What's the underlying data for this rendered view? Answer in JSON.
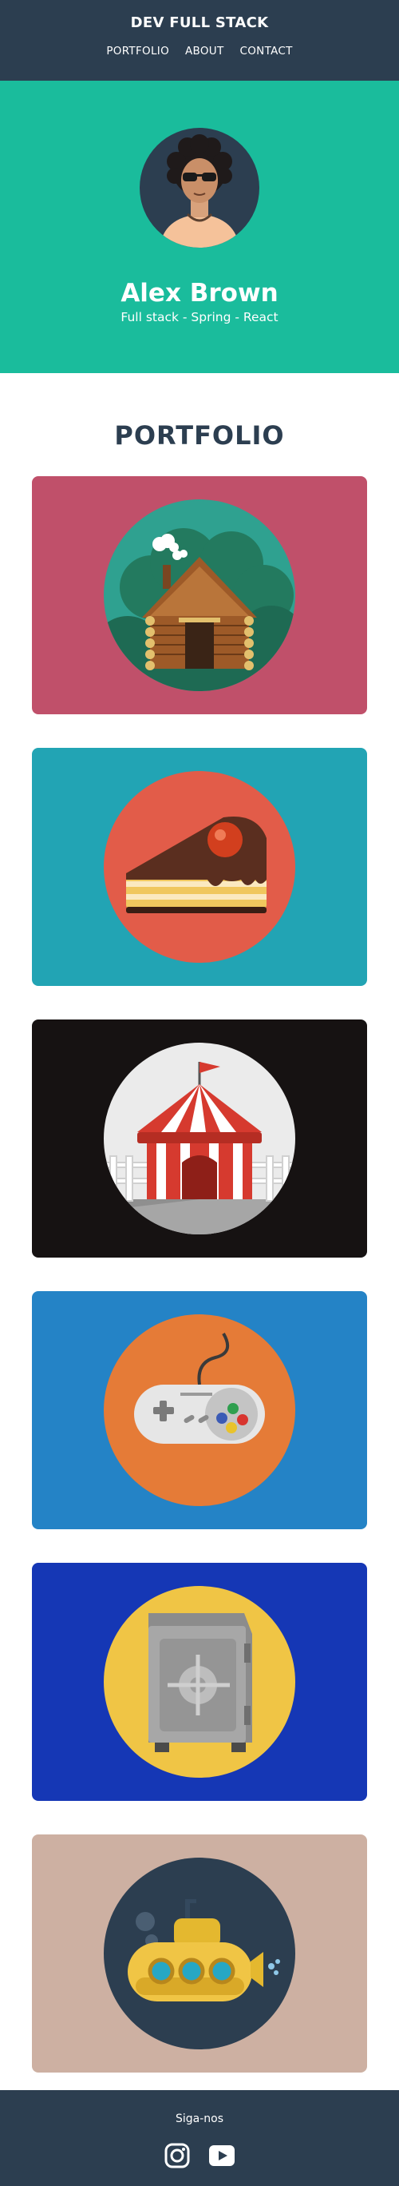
{
  "navbar": {
    "brand": "DEV FULL STACK",
    "links": [
      "PORTFOLIO",
      "ABOUT",
      "CONTACT"
    ]
  },
  "hero": {
    "name": "Alex Brown",
    "subtitle": "Full stack - Spring - React"
  },
  "portfolio": {
    "title": "PORTFOLIO",
    "items": [
      {
        "icon": "cabin-icon",
        "bg": "#c0506a",
        "circle": "#2fa190"
      },
      {
        "icon": "cake-icon",
        "bg": "#22a4b4",
        "circle": "#e25c49"
      },
      {
        "icon": "circus-tent-icon",
        "bg": "#161212",
        "circle": "#ebebeb"
      },
      {
        "icon": "game-controller-icon",
        "bg": "#2483c6",
        "circle": "#e57b37"
      },
      {
        "icon": "safe-icon",
        "bg": "#1537b5",
        "circle": "#f0c545"
      },
      {
        "icon": "submarine-icon",
        "bg": "#cdb0a2",
        "circle": "#2c3e50"
      }
    ]
  },
  "footer": {
    "text": "Siga-nos",
    "social": [
      "instagram-icon",
      "youtube-icon"
    ]
  },
  "colors": {
    "nav": "#2c3e50",
    "hero": "#1abc9c",
    "title": "#2c3e50"
  }
}
